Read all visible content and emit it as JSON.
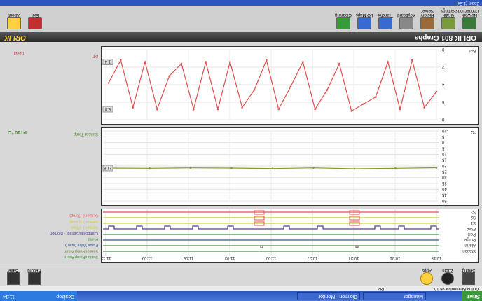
{
  "taskbar": {
    "start_label": "Start",
    "tasks": [
      "Manager",
      "Bio mon - Monitor",
      "PM"
    ],
    "clock": "11:14",
    "tray_text": "Desktop"
  },
  "title_row": {
    "left": "Online Biomonitor v6.10",
    "right": "PM"
  },
  "top_toolbar": {
    "buttons": [
      {
        "label": "Setting",
        "icon": "setting-icon"
      },
      {
        "label": "Zoom",
        "icon": "zoom-icon"
      },
      {
        "label": "Apps",
        "icon": "apps-icon"
      }
    ],
    "right_buttons": [
      {
        "label": "Record",
        "icon": "record-icon"
      },
      {
        "label": "Save",
        "icon": "save-icon"
      }
    ]
  },
  "time_axis": [
    "10:18",
    "10:21",
    "10:24",
    "10:27",
    "11:00",
    "11:03",
    "11:06",
    "11:09",
    "11:12"
  ],
  "event_panel": {
    "rows": [
      "Station",
      "Alarm",
      "Purge",
      "Port",
      "EWA",
      "S1",
      "S2",
      "S3"
    ],
    "legend": [
      {
        "text": "Station/Pump Alarm",
        "color": "#3a9a3a"
      },
      {
        "text": "Sensor/Pump Alarm",
        "color": "#6a8a30"
      },
      {
        "text": "Purge Valve (open)",
        "color": "#2a5a9a"
      },
      {
        "text": "Pump",
        "color": "#3a9a3a"
      },
      {
        "text": "Composite/Sensor - Biomon",
        "color": "#5a3a9a"
      },
      {
        "text": "Sensor 1 (Flow)",
        "color": "#c9c93a"
      },
      {
        "text": "Sensor 2 (Level)",
        "color": "#c9c93a"
      },
      {
        "text": "Sensor 3 (Temp)",
        "color": "#e05050"
      }
    ]
  },
  "temp_chart": {
    "y_ticks": [
      "50",
      "45",
      "40",
      "35",
      "30",
      "25",
      "20",
      "15",
      "10",
      "5",
      "0",
      "-5",
      "-10"
    ],
    "unit_label": "°C",
    "value_label": "PT10 °C",
    "side_label": "Sensor Temp",
    "marker": "21.8"
  },
  "level_chart": {
    "y_ticks": [
      "8",
      "6",
      "4",
      "2",
      "0"
    ],
    "unit_label": "Bar",
    "value_label": "Level",
    "side_label": "PT",
    "marker_hi": "6.8",
    "marker_lo": "1.4"
  },
  "banner": {
    "title": "ORLIK 801 Graphs",
    "brand": "ORLIK"
  },
  "bottom_bar": {
    "buttons": [
      {
        "label": "Network",
        "sub": "Connections",
        "icon": "network-icon"
      },
      {
        "label": "Grafik",
        "sub": "Settings",
        "icon": "graph-icon"
      },
      {
        "label": "History",
        "sub": "Server",
        "icon": "history-icon"
      },
      {
        "label": "Keyboard",
        "sub": "",
        "icon": "keyboard-icon"
      },
      {
        "label": "Transfer",
        "sub": "",
        "icon": "transfer-icon"
      },
      {
        "label": "I/O Maps",
        "sub": "",
        "icon": "io-icon"
      },
      {
        "label": "Cleaning",
        "sub": "",
        "icon": "clean-icon"
      }
    ],
    "right_buttons": [
      {
        "label": "Exit",
        "icon": "exit-icon"
      },
      {
        "label": "About",
        "icon": "about-icon"
      }
    ]
  },
  "status_bar": {
    "text": "Zoom (1.5x)"
  },
  "chart_data": [
    {
      "type": "line",
      "title": "",
      "ylabel": "°C",
      "ylim": [
        -10,
        50
      ],
      "x": [
        "10:18",
        "10:21",
        "10:24",
        "10:27",
        "11:00",
        "11:03",
        "11:06",
        "11:09",
        "11:12"
      ],
      "series": [
        {
          "name": "PT10 °C",
          "values": [
            21.5,
            22.0,
            22.4,
            21.6,
            22.2,
            21.8,
            21.6,
            22.0,
            21.8
          ]
        }
      ]
    },
    {
      "type": "line",
      "title": "",
      "ylabel": "Bar",
      "ylim": [
        0,
        8
      ],
      "series": [
        {
          "name": "Level",
          "values": [
            4.8,
            6.6,
            1.2,
            6.8,
            1.4,
            5.4,
            6.2,
            7.0,
            1.6,
            4.6,
            6.8,
            1.4,
            4.2,
            6.8,
            1.2,
            4.6,
            6.6,
            1.4,
            6.8,
            1.4,
            6.8,
            1.6,
            3.0,
            6.8,
            1.4,
            6.6,
            1.2,
            3.8
          ]
        }
      ]
    }
  ]
}
